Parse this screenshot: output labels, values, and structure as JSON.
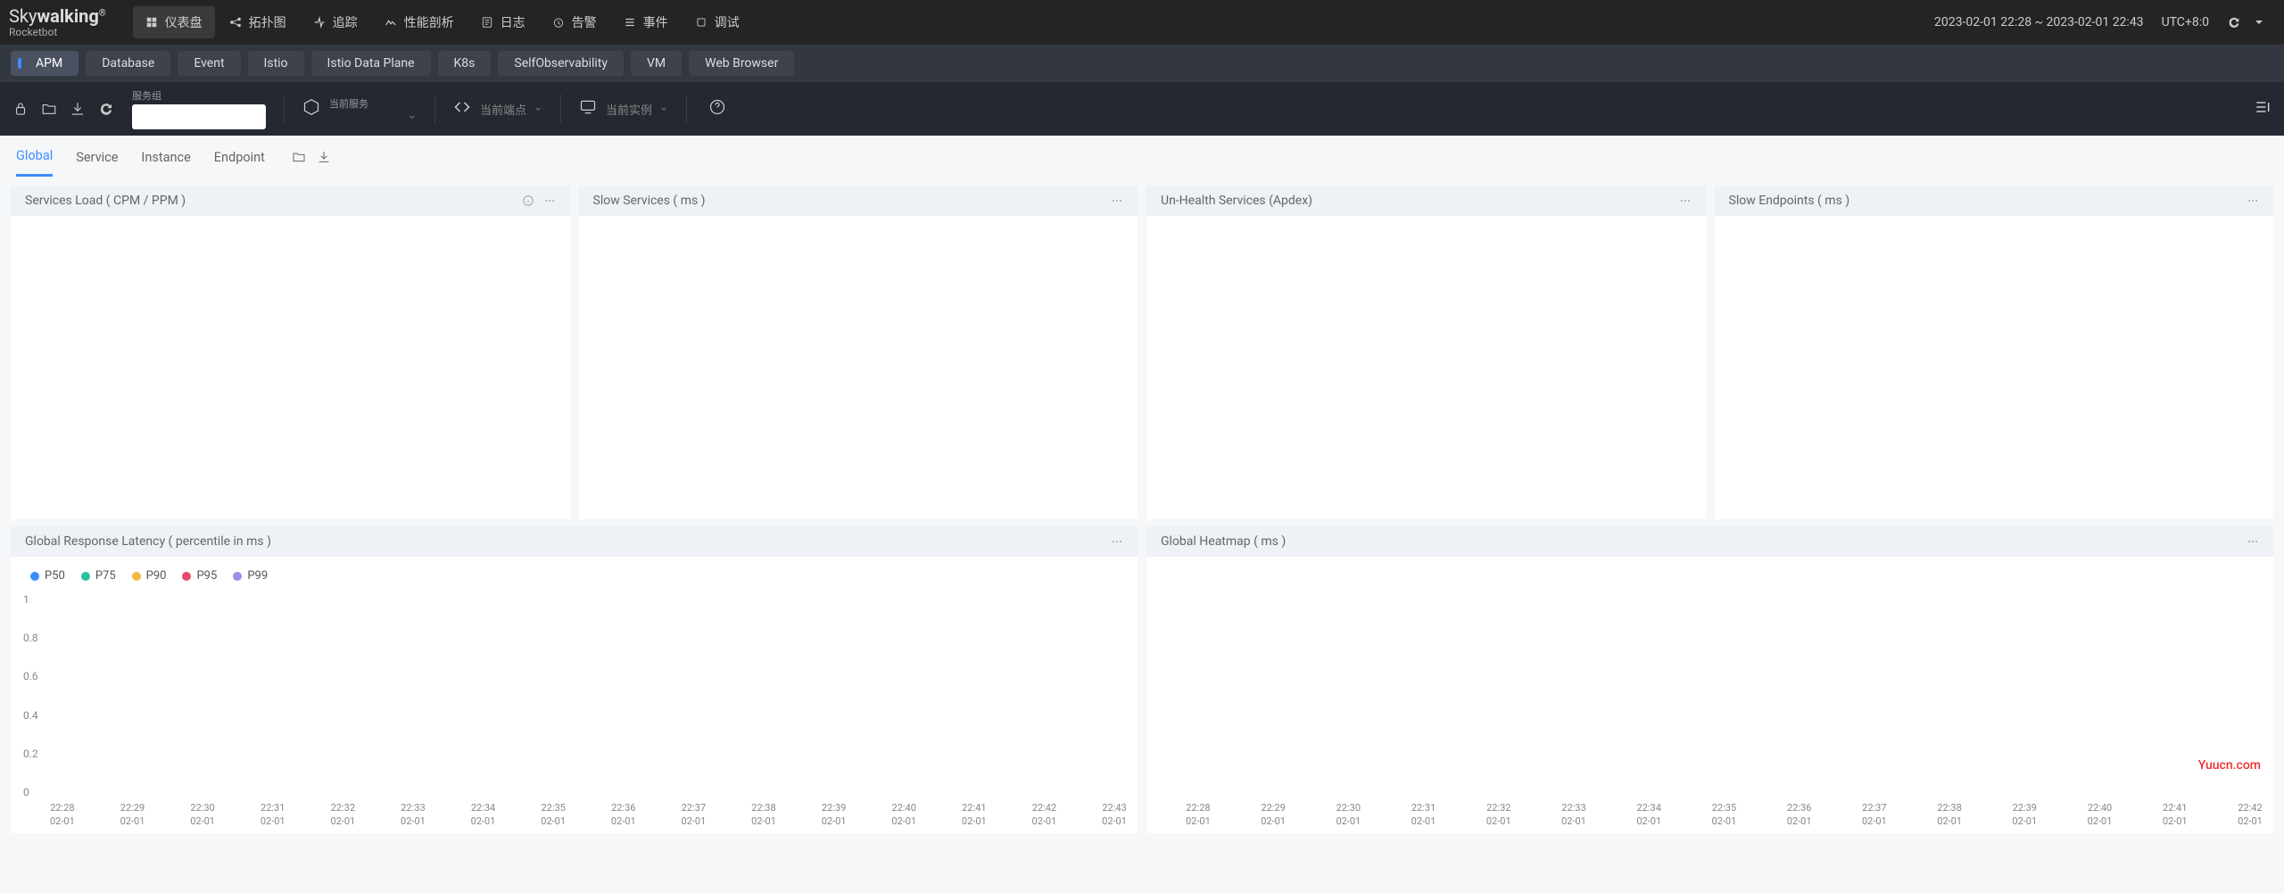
{
  "brand": {
    "name_a": "Sky",
    "name_b": "walking",
    "sub": "Rocketbot"
  },
  "topnav": [
    {
      "label": "仪表盘"
    },
    {
      "label": "拓扑图"
    },
    {
      "label": "追踪"
    },
    {
      "label": "性能剖析"
    },
    {
      "label": "日志"
    },
    {
      "label": "告警"
    },
    {
      "label": "事件"
    },
    {
      "label": "调试"
    }
  ],
  "time_range": "2023-02-01 22:28 ~ 2023-02-01 22:43",
  "timezone": "UTC+8:0",
  "tabs": [
    "APM",
    "Database",
    "Event",
    "Istio",
    "Istio Data Plane",
    "K8s",
    "SelfObservability",
    "VM",
    "Web Browser"
  ],
  "selectors": {
    "group_label": "服务组",
    "service_label": "当前服务",
    "service_value": "",
    "endpoint_label": "当前端点",
    "instance_label": "当前实例"
  },
  "subnav": [
    "Global",
    "Service",
    "Instance",
    "Endpoint"
  ],
  "panels_row1": [
    {
      "title": "Services Load ( CPM / PPM )",
      "info": true
    },
    {
      "title": "Slow Services ( ms )",
      "info": false
    },
    {
      "title": "Un-Health Services (Apdex)",
      "info": false
    },
    {
      "title": "Slow Endpoints ( ms )",
      "info": false
    }
  ],
  "panels_row2": [
    {
      "title": "Global Response Latency ( percentile in ms )"
    },
    {
      "title": "Global Heatmap ( ms )"
    }
  ],
  "chart_data": {
    "type": "line",
    "title": "Global Response Latency ( percentile in ms )",
    "ylabel": "",
    "ylim": [
      0,
      1
    ],
    "yticks": [
      0,
      0.2,
      0.4,
      0.6,
      0.8,
      1
    ],
    "series": [
      {
        "name": "P50",
        "color": "#3f8cff",
        "values": [
          0,
          0,
          0,
          0,
          0,
          0,
          0,
          0,
          0,
          0,
          0,
          0,
          0,
          0,
          0,
          0
        ]
      },
      {
        "name": "P75",
        "color": "#2bbfa4",
        "values": [
          0,
          0,
          0,
          0,
          0,
          0,
          0,
          0,
          0,
          0,
          0,
          0,
          0,
          0,
          0,
          0
        ]
      },
      {
        "name": "P90",
        "color": "#f4b73f",
        "values": [
          0,
          0,
          0,
          0,
          0,
          0,
          0,
          0,
          0,
          0,
          0,
          0,
          0,
          0,
          0,
          0
        ]
      },
      {
        "name": "P95",
        "color": "#e84a6c",
        "values": [
          0,
          0,
          0,
          0,
          0,
          0,
          0,
          0,
          0,
          0,
          0,
          0,
          0,
          0,
          0,
          0
        ]
      },
      {
        "name": "P99",
        "color": "#9f8ee8",
        "values": [
          0,
          0,
          0,
          0,
          0,
          0,
          0,
          0,
          0,
          0,
          0,
          0,
          0,
          0,
          0,
          0
        ]
      }
    ],
    "x": [
      "22:28",
      "22:29",
      "22:30",
      "22:31",
      "22:32",
      "22:33",
      "22:34",
      "22:35",
      "22:36",
      "22:37",
      "22:38",
      "22:39",
      "22:40",
      "22:41",
      "22:42",
      "22:43"
    ],
    "x_sub": "02-01"
  },
  "heatmap_x": [
    "22:28",
    "22:29",
    "22:30",
    "22:31",
    "22:32",
    "22:33",
    "22:34",
    "22:35",
    "22:36",
    "22:37",
    "22:38",
    "22:39",
    "22:40",
    "22:41",
    "22:42"
  ],
  "heatmap_x_sub": "02-01",
  "watermark": "Yuucn.com"
}
